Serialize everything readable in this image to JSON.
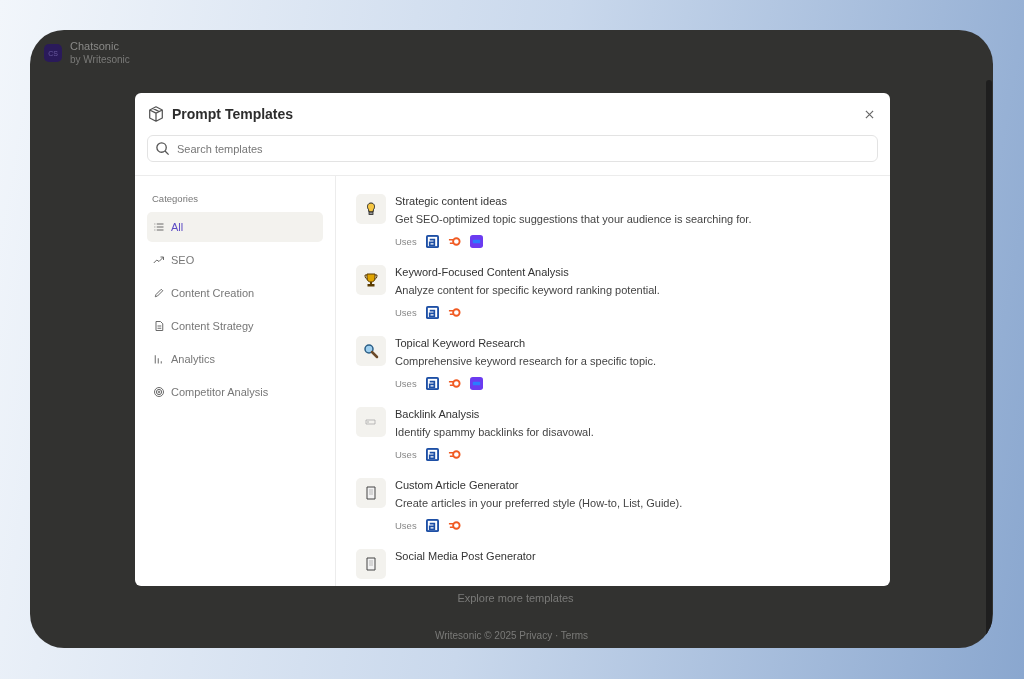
{
  "app": {
    "name": "Chatsonic",
    "byline": "by Writesonic",
    "logo": "CS",
    "explore_link": "Explore more templates",
    "footer": "Writesonic © 2025 Privacy · Terms"
  },
  "modal": {
    "title": "Prompt Templates",
    "search": {
      "placeholder": "Search templates"
    },
    "categories_heading": "Categories",
    "categories": [
      {
        "label": "All",
        "kind": "list",
        "selected": true
      },
      {
        "label": "SEO",
        "kind": "trend",
        "selected": false
      },
      {
        "label": "Content Creation",
        "kind": "pencil",
        "selected": false
      },
      {
        "label": "Content Strategy",
        "kind": "doc",
        "selected": false
      },
      {
        "label": "Analytics",
        "kind": "bars",
        "selected": false
      },
      {
        "label": "Competitor Analysis",
        "kind": "target",
        "selected": false
      }
    ],
    "templates": [
      {
        "title": "Strategic content ideas",
        "description": "Get SEO-optimized topic suggestions that your audience is searching for.",
        "kind": "bulb",
        "uses_label": "Uses",
        "tools": [
          {
            "kind": "letter"
          },
          {
            "kind": "swirl"
          },
          {
            "kind": "square"
          }
        ]
      },
      {
        "title": "Keyword-Focused Content Analysis",
        "description": "Analyze content for specific keyword ranking potential.",
        "kind": "trophy",
        "uses_label": "Uses",
        "tools": [
          {
            "kind": "letter"
          },
          {
            "kind": "swirl"
          }
        ]
      },
      {
        "title": "Topical Keyword Research",
        "description": "Comprehensive keyword research for a specific topic.",
        "kind": "magnifier",
        "uses_label": "Uses",
        "tools": [
          {
            "kind": "letter"
          },
          {
            "kind": "swirl"
          },
          {
            "kind": "square"
          }
        ]
      },
      {
        "title": "Backlink Analysis",
        "description": "Identify spammy backlinks for disavowal.",
        "kind": "tag",
        "uses_label": "Uses",
        "tools": [
          {
            "kind": "letter"
          },
          {
            "kind": "swirl"
          }
        ]
      },
      {
        "title": "Custom Article Generator",
        "description": "Create articles in your preferred style (How-to, List, Guide).",
        "kind": "page",
        "uses_label": "Uses",
        "tools": [
          {
            "kind": "letter"
          },
          {
            "kind": "swirl"
          }
        ]
      },
      {
        "title": "Social Media Post Generator",
        "kind": "page"
      }
    ]
  }
}
